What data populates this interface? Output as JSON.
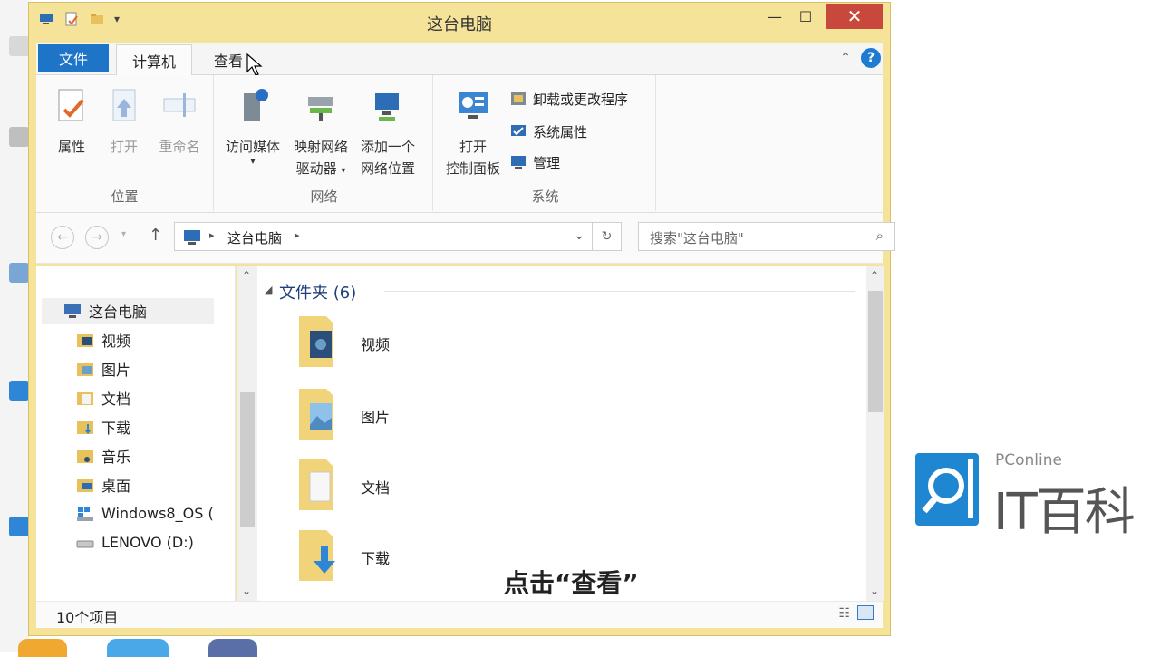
{
  "window": {
    "title": "这台电脑"
  },
  "tabs": {
    "file": "文件",
    "computer": "计算机",
    "view": "查看"
  },
  "ribbon": {
    "location": {
      "label": "位置",
      "properties": "属性",
      "open": "打开",
      "rename": "重命名"
    },
    "network": {
      "label": "网络",
      "media_line1": "访问媒体",
      "map_line1": "映射网络",
      "map_line2": "驱动器",
      "add_line1": "添加一个",
      "add_line2": "网络位置"
    },
    "system": {
      "label": "系统",
      "open_line1": "打开",
      "open_line2": "控制面板",
      "uninstall": "卸载或更改程序",
      "sysprops": "系统属性",
      "manage": "管理"
    }
  },
  "address": {
    "path": "这台电脑",
    "search_placeholder": "搜索\"这台电脑\""
  },
  "navpane": {
    "items": [
      {
        "label": "这台电脑",
        "icon": "computer-icon",
        "color": "#3b6fb6"
      },
      {
        "label": "视频",
        "icon": "folder-video-icon",
        "color": "#e8c15a"
      },
      {
        "label": "图片",
        "icon": "folder-pictures-icon",
        "color": "#e8c15a"
      },
      {
        "label": "文档",
        "icon": "folder-documents-icon",
        "color": "#e8c15a"
      },
      {
        "label": "下载",
        "icon": "folder-downloads-icon",
        "color": "#e8c15a"
      },
      {
        "label": "音乐",
        "icon": "folder-music-icon",
        "color": "#e8c15a"
      },
      {
        "label": "桌面",
        "icon": "folder-desktop-icon",
        "color": "#e8c15a"
      },
      {
        "label": "Windows8_OS (",
        "icon": "drive-windows-icon",
        "color": "#6aa0c8"
      },
      {
        "label": "LENOVO (D:)",
        "icon": "drive-icon",
        "color": "#9a9a9a"
      }
    ]
  },
  "content": {
    "group_header": "文件夹 (6)",
    "folders": [
      {
        "label": "视频",
        "icon": "folder-video-icon"
      },
      {
        "label": "图片",
        "icon": "folder-pictures-icon"
      },
      {
        "label": "文档",
        "icon": "folder-documents-icon"
      },
      {
        "label": "下载",
        "icon": "folder-downloads-icon"
      }
    ]
  },
  "status": {
    "count": "10个项目"
  },
  "subtitle": "点击“查看”",
  "logo": {
    "top": "PConline",
    "main": "IT百科"
  },
  "colors": {
    "accent": "#1e74c7",
    "window_frame": "#f5e39a",
    "close": "#c9483c"
  }
}
